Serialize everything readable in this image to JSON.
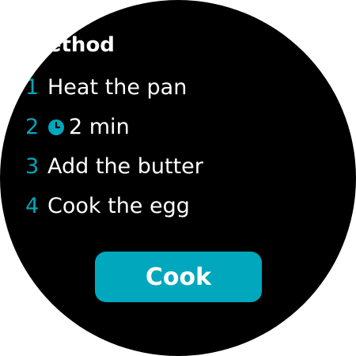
{
  "accent_color": "#00a7bd",
  "method": {
    "heading": "Method",
    "steps": [
      {
        "number": "1",
        "text": "Heat the pan"
      },
      {
        "number": "2",
        "text": "2 min",
        "icon": "timer-icon"
      },
      {
        "number": "3",
        "text": "Add the butter"
      },
      {
        "number": "4",
        "text": "Cook the egg"
      }
    ]
  },
  "actions": {
    "cook_label": "Cook"
  }
}
